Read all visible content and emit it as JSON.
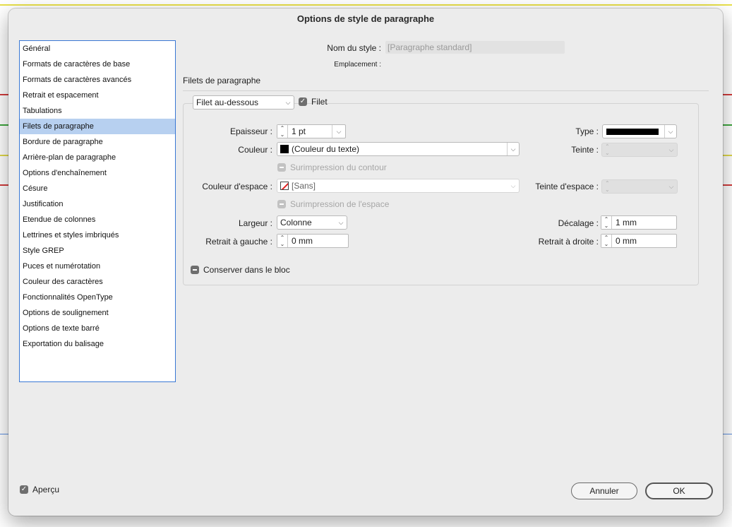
{
  "window": {
    "title": "Options de style de paragraphe"
  },
  "sidebar": {
    "items": [
      {
        "label": "Général"
      },
      {
        "label": "Formats de caractères de base"
      },
      {
        "label": "Formats de caractères avancés"
      },
      {
        "label": "Retrait et espacement"
      },
      {
        "label": "Tabulations"
      },
      {
        "label": "Filets de paragraphe",
        "selected": true
      },
      {
        "label": "Bordure de paragraphe"
      },
      {
        "label": "Arrière-plan de paragraphe"
      },
      {
        "label": "Options d'enchaînement"
      },
      {
        "label": "Césure"
      },
      {
        "label": "Justification"
      },
      {
        "label": "Etendue de colonnes"
      },
      {
        "label": "Lettrines et styles imbriqués"
      },
      {
        "label": "Style GREP"
      },
      {
        "label": "Puces et numérotation"
      },
      {
        "label": "Couleur des caractères"
      },
      {
        "label": "Fonctionnalités OpenType"
      },
      {
        "label": "Options de soulignement"
      },
      {
        "label": "Options de texte barré"
      },
      {
        "label": "Exportation du balisage"
      }
    ]
  },
  "header": {
    "style_name_label": "Nom du style :",
    "style_name_value": "[Paragraphe standard]",
    "location_label": "Emplacement :"
  },
  "section": {
    "title": "Filets de paragraphe"
  },
  "rule": {
    "position_select": "Filet au-dessous",
    "rule_on_label": "Filet",
    "rule_on_checked": true,
    "weight_label": "Epaisseur :",
    "weight_value": "1 pt",
    "type_label": "Type :",
    "color_label": "Couleur :",
    "color_value": "(Couleur du texte)",
    "tint_label": "Teinte :",
    "overprint_stroke_label": "Surimpression du contour",
    "gap_color_label": "Couleur d'espace :",
    "gap_color_value": "[Sans]",
    "gap_tint_label": "Teinte d'espace :",
    "overprint_gap_label": "Surimpression de l'espace",
    "width_label": "Largeur :",
    "width_value": "Colonne",
    "offset_label": "Décalage :",
    "offset_value": "1 mm",
    "left_indent_label": "Retrait à gauche :",
    "left_indent_value": "0 mm",
    "right_indent_label": "Retrait à droite :",
    "right_indent_value": "0 mm",
    "keep_in_frame_label": "Conserver dans le bloc"
  },
  "footer": {
    "preview_label": "Aperçu",
    "preview_checked": true,
    "cancel_label": "Annuler",
    "ok_label": "OK"
  },
  "icons": {
    "checkmark": "check-icon",
    "dropdown": "chevron-down-icon",
    "stepper": "stepper-icon"
  },
  "colors": {
    "selection": "#b7d0f0",
    "accent_border": "#3a78d4",
    "dialog_bg": "#ececec"
  }
}
